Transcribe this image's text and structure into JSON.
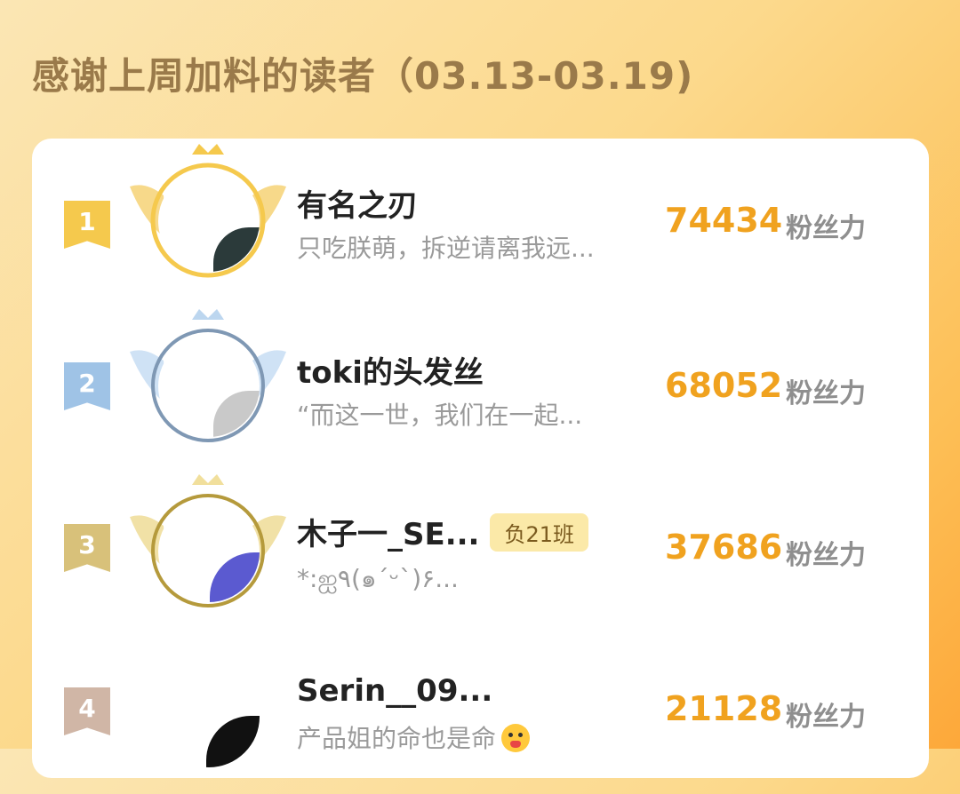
{
  "title": "感谢上周加料的读者（03.13-03.19)",
  "colors": {
    "rank1": "#f5c94d",
    "rank2": "#9fc3e6",
    "rank3": "#d8c17a",
    "rank4": "#d0b6a6",
    "score": "#f0a21f"
  },
  "readers": [
    {
      "rank": "1",
      "name": "有名之刃",
      "signature": "只吃朕萌，拆逆请离我远...",
      "score": "74434",
      "unit": "粉丝力",
      "frame_icon": "gold-crown-frame-icon"
    },
    {
      "rank": "2",
      "name": "toki的头发丝",
      "signature": "“而这一世，我们在一起...",
      "score": "68052",
      "unit": "粉丝力",
      "frame_icon": "silver-crown-frame-icon"
    },
    {
      "rank": "3",
      "name": "木子一_SE...",
      "badge": "负21班",
      "signature": "*:ஐ٩(๑´ᵕ`)۶...",
      "score": "37686",
      "unit": "粉丝力",
      "frame_icon": "bronze-crown-frame-icon"
    },
    {
      "rank": "4",
      "name": "Serin__09...",
      "signature": "产品姐的命也是命",
      "score": "21128",
      "unit": "粉丝力",
      "emoji_icon": "crying-face-icon"
    }
  ]
}
